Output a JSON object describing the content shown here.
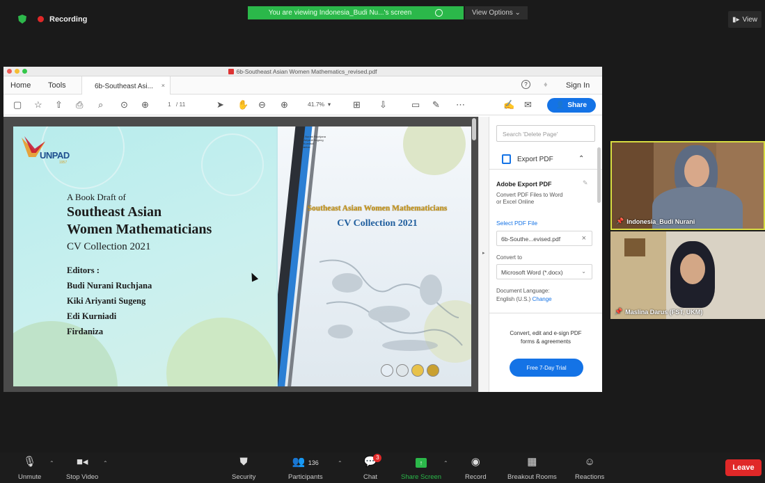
{
  "zoom": {
    "recording_label": "Recording",
    "viewing_text": "You are viewing Indonesia_Budi Nu...'s screen",
    "view_options": "View Options ⌄",
    "view_button": "View",
    "colors": {
      "viewing_banner": "#2bb84a",
      "leave": "#e02828"
    }
  },
  "acrobat": {
    "window_title": "6b-Southeast Asian Women Mathematics_revised.pdf",
    "tabs": {
      "home": "Home",
      "tools": "Tools",
      "document_tab": "6b-Southeast Asi...",
      "close": "×",
      "help": "?",
      "sign_in": "Sign In"
    },
    "toolbar": {
      "page_current": "1",
      "page_total": "/ 11",
      "zoom": "41.7%",
      "share": "Share"
    },
    "document": {
      "logo": {
        "text": "UNPAD",
        "sub": "1957"
      },
      "line1": "A Book Draft of",
      "line2": "Southeast Asian",
      "line3": "Women Mathematicians",
      "line4": "CV Collection 2021",
      "editors_label": "Editors :",
      "editors": [
        "Budi Nurani Ruchjana",
        "Kiki Ariyanti Sugeng",
        "Edi Kurniadi",
        "Firdaniza"
      ],
      "cover_title": "Southeast Asian Women Mathematicians",
      "cover_subtitle": "CV Collection 2021",
      "cover_small": [
        "Budi Nurani Ruchjana",
        "Kiki Ariyanti Sugeng",
        "Edi Kurniadi",
        "Firdaniza"
      ]
    },
    "right_panel": {
      "search_placeholder": "Search 'Delete Page'",
      "export_label": "Export PDF",
      "adobe_export_title": "Adobe Export PDF",
      "adobe_export_desc1": "Convert PDF Files to Word",
      "adobe_export_desc2": "or Excel Online",
      "select_file": "Select PDF File",
      "file_name": "6b-Southe...evised.pdf",
      "convert_to": "Convert to",
      "format": "Microsoft Word (*.docx)",
      "doc_language_label": "Document Language:",
      "doc_language": "English (U.S.)",
      "change": "Change",
      "promo1": "Convert, edit and e-sign PDF",
      "promo2": "forms & agreements",
      "trial": "Free 7-Day Trial"
    }
  },
  "participants": [
    {
      "name": "Indonesia_Budi Nurani"
    },
    {
      "name": "Maslina Darus (FST, UKM)"
    }
  ],
  "controls": {
    "unmute": "Unmute",
    "stop_video": "Stop Video",
    "security": "Security",
    "participants": "Participants",
    "participant_count": "136",
    "chat": "Chat",
    "chat_badge": "3",
    "share_screen": "Share Screen",
    "record": "Record",
    "breakout_rooms": "Breakout Rooms",
    "reactions": "Reactions",
    "leave": "Leave"
  }
}
